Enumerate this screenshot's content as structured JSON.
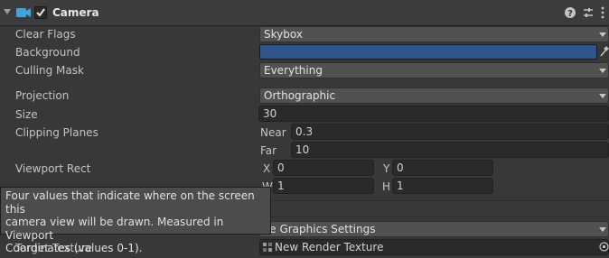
{
  "component": {
    "title": "Camera",
    "enabled": true,
    "icons": {
      "camera": "camera-icon",
      "help": "help-icon",
      "presets": "presets-icon",
      "menu": "kebab-menu-icon"
    }
  },
  "props": {
    "clear_flags": {
      "label": "Clear Flags",
      "value": "Skybox"
    },
    "background": {
      "label": "Background",
      "color": "#2f558e"
    },
    "culling_mask": {
      "label": "Culling Mask",
      "value": "Everything"
    },
    "projection": {
      "label": "Projection",
      "value": "Orthographic"
    },
    "size": {
      "label": "Size",
      "value": "30"
    },
    "clipping_planes": {
      "label": "Clipping Planes",
      "near_label": "Near",
      "near_value": "0.3",
      "far_label": "Far",
      "far_value": "10"
    },
    "viewport_rect": {
      "label": "Viewport Rect",
      "x_label": "X",
      "x_value": "0",
      "y_label": "Y",
      "y_value": "0",
      "w_label": "W",
      "w_value": "1",
      "h_label": "H",
      "h_value": "1"
    },
    "rendering_path": {
      "value": "se Graphics Settings"
    },
    "target_texture": {
      "label": "Target Texture",
      "value": "New Render Texture"
    }
  },
  "tooltip": {
    "lines": [
      "Four values that indicate where on the screen this",
      "camera view will be drawn. Measured in Viewport",
      "Coordinates (values 0-1)."
    ]
  }
}
